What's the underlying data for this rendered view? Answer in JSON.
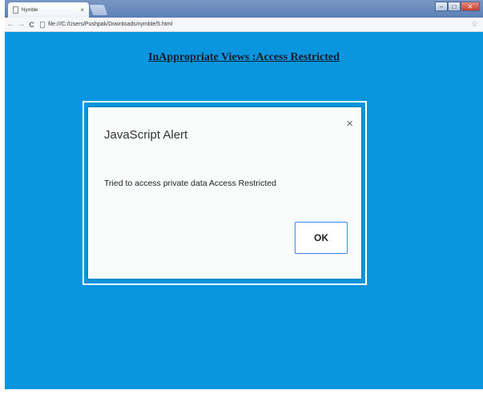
{
  "browser": {
    "tab_title": "Nymble",
    "tab_close": "×",
    "url": "file:///C:/Users/Pushpak/Downloads/nymble/5.html",
    "back": "←",
    "forward": "→",
    "reload": "C",
    "star": "☆",
    "minimize": "–",
    "maximize": "□",
    "close": "✕"
  },
  "page": {
    "heading": "InAppropriate Views :Access Restricted"
  },
  "alert": {
    "title": "JavaScript Alert",
    "close": "×",
    "message": "Tried to access private data Access Restricted",
    "ok_label": "OK"
  },
  "colors": {
    "page_background": "#0a96de",
    "button_focus": "#4d90fe"
  }
}
